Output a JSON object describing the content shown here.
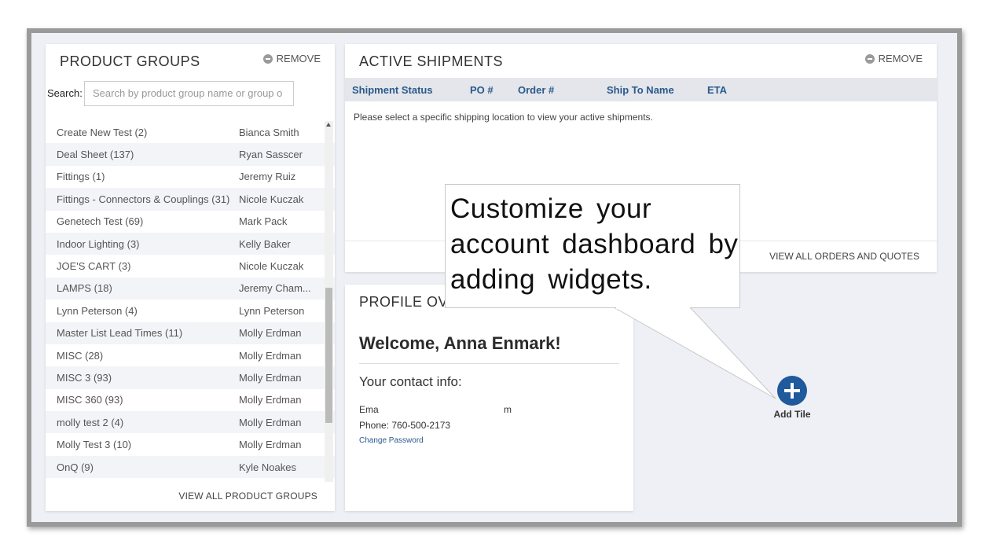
{
  "product_groups": {
    "title": "PRODUCT GROUPS",
    "remove_label": "REMOVE",
    "search_label": "Search:",
    "search_placeholder": "Search by product group name or group o",
    "rows": [
      {
        "name": "Create New Test (2)",
        "owner": "Bianca Smith"
      },
      {
        "name": "Deal Sheet (137)",
        "owner": "Ryan Sasscer"
      },
      {
        "name": "Fittings (1)",
        "owner": "Jeremy Ruiz"
      },
      {
        "name": "Fittings - Connectors & Couplings (31)",
        "owner": "Nicole Kuczak"
      },
      {
        "name": "Genetech Test (69)",
        "owner": "Mark Pack"
      },
      {
        "name": "Indoor Lighting (3)",
        "owner": "Kelly Baker"
      },
      {
        "name": "JOE'S CART (3)",
        "owner": "Nicole Kuczak"
      },
      {
        "name": "LAMPS (18)",
        "owner": "Jeremy Cham..."
      },
      {
        "name": "Lynn Peterson (4)",
        "owner": "Lynn Peterson"
      },
      {
        "name": "Master List Lead Times (11)",
        "owner": "Molly Erdman"
      },
      {
        "name": "MISC (28)",
        "owner": "Molly Erdman"
      },
      {
        "name": "MISC 3 (93)",
        "owner": "Molly Erdman"
      },
      {
        "name": "MISC 360 (93)",
        "owner": "Molly Erdman"
      },
      {
        "name": "molly test 2 (4)",
        "owner": "Molly Erdman"
      },
      {
        "name": "Molly Test 3 (10)",
        "owner": "Molly Erdman"
      },
      {
        "name": "OnQ (9)",
        "owner": "Kyle Noakes"
      }
    ],
    "view_all": "VIEW ALL PRODUCT GROUPS"
  },
  "active_shipments": {
    "title": "ACTIVE SHIPMENTS",
    "remove_label": "REMOVE",
    "columns": [
      "Shipment Status",
      "PO #",
      "Order #",
      "Ship To Name",
      "ETA"
    ],
    "message": "Please select a specific shipping location to view your active shipments.",
    "view_all": "VIEW ALL ORDERS AND QUOTES"
  },
  "profile": {
    "title": "PROFILE OVE",
    "welcome": "Welcome, Anna Enmark!",
    "contact_heading": "Your contact info:",
    "email_prefix": "Ema",
    "email_suffix": "m",
    "phone": "Phone: 760-500-2173",
    "change_password": "Change Password"
  },
  "add_tile": {
    "label": "Add Tile",
    "icon": "plus-circle-icon",
    "color": "#1e5a9c"
  },
  "callout": {
    "text": "Customize your account dashboard by adding widgets."
  },
  "colors": {
    "accent_blue": "#1e5a9c",
    "header_link": "#2a5a8c",
    "background": "#eef0f5"
  }
}
